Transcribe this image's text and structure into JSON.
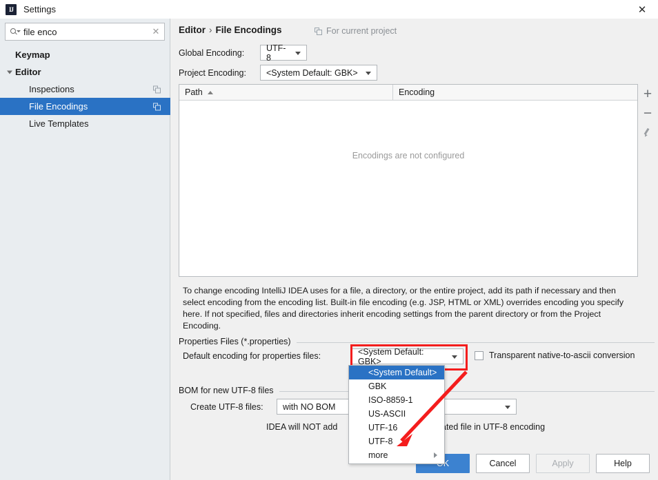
{
  "window": {
    "title": "Settings",
    "logo_icon": "intellij-idea-logo-icon",
    "close_icon": "✕"
  },
  "sidebar": {
    "search": {
      "value": "file enco",
      "placeholder": "",
      "search_icon": "search-icon",
      "clear_icon": "✕"
    },
    "items": [
      {
        "label": "Keymap",
        "level": 0,
        "selected": false,
        "expandable": false,
        "scope_icon": false
      },
      {
        "label": "Editor",
        "level": 0,
        "selected": false,
        "expandable": true,
        "scope_icon": false
      },
      {
        "label": "Inspections",
        "level": 1,
        "selected": false,
        "expandable": false,
        "scope_icon": true
      },
      {
        "label": "File Encodings",
        "level": 1,
        "selected": true,
        "expandable": false,
        "scope_icon": true
      },
      {
        "label": "Live Templates",
        "level": 1,
        "selected": false,
        "expandable": false,
        "scope_icon": false
      }
    ]
  },
  "content": {
    "breadcrumb": {
      "parent": "Editor",
      "separator": "›",
      "current": "File Encodings"
    },
    "for_current_project": "For current project",
    "global_encoding": {
      "label": "Global Encoding:",
      "value": "UTF-8"
    },
    "project_encoding": {
      "label": "Project Encoding:",
      "value": "<System Default: GBK>"
    },
    "table": {
      "columns": [
        "Path",
        "Encoding"
      ],
      "sort_column": "Path",
      "sort_direction": "ascending",
      "rows": [],
      "empty_message": "Encodings are not configured",
      "buttons": [
        {
          "name": "add",
          "glyph": "+"
        },
        {
          "name": "remove",
          "glyph": "−"
        },
        {
          "name": "edit",
          "glyph": "pencil"
        }
      ]
    },
    "description": "To change encoding IntelliJ IDEA uses for a file, a directory, or the entire project, add its path if necessary and then select encoding from the encoding list. Built-in file encoding (e.g. JSP, HTML or XML) overrides encoding you specify here. If not specified, files and directories inherit encoding settings from the parent directory or from the Project Encoding.",
    "properties_group": {
      "title": "Properties Files (*.properties)",
      "default_encoding_label": "Default encoding for properties files:",
      "default_encoding_value": "<System Default: GBK>",
      "transparent_checkbox_label": "Transparent native-to-ascii conversion",
      "transparent_checkbox_checked": false
    },
    "bom_group": {
      "title": "BOM for new UTF-8 files",
      "create_label": "Create UTF-8 files:",
      "create_value": "with NO BOM",
      "hint_left": "IDEA will NOT add",
      "hint_right": "ated file in UTF-8 encoding"
    },
    "encoding_dropdown": {
      "open": true,
      "items": [
        {
          "label": "<System Default>",
          "selected": true,
          "submenu": false
        },
        {
          "label": "GBK",
          "selected": false,
          "submenu": false
        },
        {
          "label": "ISO-8859-1",
          "selected": false,
          "submenu": false
        },
        {
          "label": "US-ASCII",
          "selected": false,
          "submenu": false
        },
        {
          "label": "UTF-16",
          "selected": false,
          "submenu": false
        },
        {
          "label": "UTF-8",
          "selected": false,
          "submenu": false
        },
        {
          "label": "more",
          "selected": false,
          "submenu": true
        }
      ]
    },
    "annotations": {
      "highlight_color": "#f41d1d",
      "rectangle_target": "default-encoding-combo",
      "arrow_target": "UTF-8"
    }
  },
  "footer": {
    "buttons": [
      {
        "label": "OK",
        "style": "primary",
        "enabled": true
      },
      {
        "label": "Cancel",
        "style": "default",
        "enabled": true
      },
      {
        "label": "Apply",
        "style": "disabled",
        "enabled": false
      },
      {
        "label": "Help",
        "style": "default",
        "enabled": true
      }
    ]
  }
}
